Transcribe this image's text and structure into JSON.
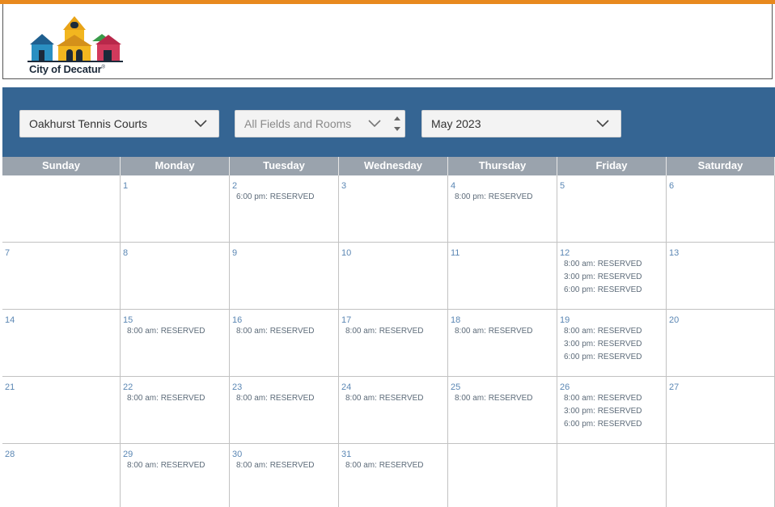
{
  "logo": {
    "name": "City of Decatur",
    "mark": "®"
  },
  "filters": {
    "venue": "Oakhurst Tennis Courts",
    "fields_placeholder": "All Fields and Rooms",
    "month": "May 2023"
  },
  "weekdays": [
    "Sunday",
    "Monday",
    "Tuesday",
    "Wednesday",
    "Thursday",
    "Friday",
    "Saturday"
  ],
  "weeks": [
    [
      {
        "day": "",
        "events": []
      },
      {
        "day": "1",
        "events": []
      },
      {
        "day": "2",
        "events": [
          "6:00 pm: RESERVED"
        ]
      },
      {
        "day": "3",
        "events": []
      },
      {
        "day": "4",
        "events": [
          "8:00 pm: RESERVED"
        ]
      },
      {
        "day": "5",
        "events": []
      },
      {
        "day": "6",
        "events": []
      }
    ],
    [
      {
        "day": "7",
        "events": []
      },
      {
        "day": "8",
        "events": []
      },
      {
        "day": "9",
        "events": []
      },
      {
        "day": "10",
        "events": []
      },
      {
        "day": "11",
        "events": []
      },
      {
        "day": "12",
        "events": [
          "8:00 am: RESERVED",
          "3:00 pm: RESERVED",
          "6:00 pm: RESERVED"
        ]
      },
      {
        "day": "13",
        "events": []
      }
    ],
    [
      {
        "day": "14",
        "events": []
      },
      {
        "day": "15",
        "events": [
          "8:00 am: RESERVED"
        ]
      },
      {
        "day": "16",
        "events": [
          "8:00 am: RESERVED"
        ]
      },
      {
        "day": "17",
        "events": [
          "8:00 am: RESERVED"
        ]
      },
      {
        "day": "18",
        "events": [
          "8:00 am: RESERVED"
        ]
      },
      {
        "day": "19",
        "events": [
          "8:00 am: RESERVED",
          "3:00 pm: RESERVED",
          "6:00 pm: RESERVED"
        ]
      },
      {
        "day": "20",
        "events": []
      }
    ],
    [
      {
        "day": "21",
        "events": []
      },
      {
        "day": "22",
        "events": [
          "8:00 am: RESERVED"
        ]
      },
      {
        "day": "23",
        "events": [
          "8:00 am: RESERVED"
        ]
      },
      {
        "day": "24",
        "events": [
          "8:00 am: RESERVED"
        ]
      },
      {
        "day": "25",
        "events": [
          "8:00 am: RESERVED"
        ]
      },
      {
        "day": "26",
        "events": [
          "8:00 am: RESERVED",
          "3:00 pm: RESERVED",
          "6:00 pm: RESERVED"
        ]
      },
      {
        "day": "27",
        "events": []
      }
    ],
    [
      {
        "day": "28",
        "events": []
      },
      {
        "day": "29",
        "events": [
          "8:00 am: RESERVED"
        ]
      },
      {
        "day": "30",
        "events": [
          "8:00 am: RESERVED"
        ]
      },
      {
        "day": "31",
        "events": [
          "8:00 am: RESERVED"
        ]
      },
      {
        "day": "",
        "events": []
      },
      {
        "day": "",
        "events": []
      },
      {
        "day": "",
        "events": []
      }
    ]
  ],
  "icons": {
    "dropdown": "chevron-down-icon",
    "spinner": "up-down-spinner-icon",
    "logo": "city-buildings-logo"
  },
  "colors": {
    "accent_bar": "#e8891e",
    "filter_bar": "#356593",
    "header_bar": "#9aa3ad",
    "day_number": "#5b87b4"
  }
}
